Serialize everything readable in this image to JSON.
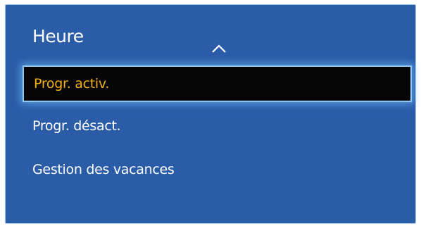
{
  "menu": {
    "title": "Heure",
    "items": [
      {
        "label": "Progr. activ.",
        "selected": true
      },
      {
        "label": "Progr. désact.",
        "selected": false
      },
      {
        "label": "Gestion des vacances",
        "selected": false
      }
    ]
  },
  "icons": {
    "scroll_up": "chevron-up-icon"
  },
  "colors": {
    "panel_background": "#2a5ca8",
    "selected_background": "#050505",
    "selected_text": "#f4b016",
    "text": "#ffffff"
  }
}
